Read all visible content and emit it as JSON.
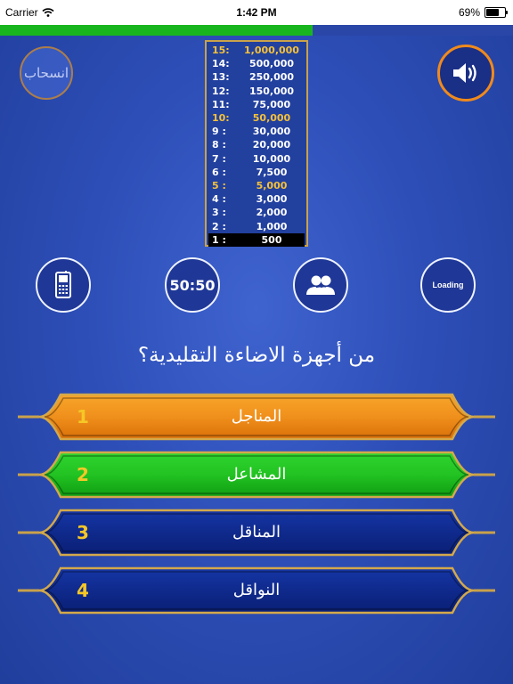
{
  "status_bar": {
    "carrier": "Carrier",
    "time": "1:42 PM",
    "battery": "69%",
    "battery_level": 0.69
  },
  "timer": {
    "progress": 0.61,
    "color": "#19b51f"
  },
  "top_buttons": {
    "withdraw_label": "انسحاب",
    "sound_icon": "speaker-icon"
  },
  "ladder": {
    "rows": [
      {
        "level": "15:",
        "amount": "1,000,000",
        "milestone": true
      },
      {
        "level": "14:",
        "amount": "500,000"
      },
      {
        "level": "13:",
        "amount": "250,000"
      },
      {
        "level": "12:",
        "amount": "150,000"
      },
      {
        "level": "11:",
        "amount": "75,000"
      },
      {
        "level": "10:",
        "amount": "50,000",
        "milestone": true
      },
      {
        "level": "9 :",
        "amount": "30,000"
      },
      {
        "level": "8 :",
        "amount": "20,000"
      },
      {
        "level": "7 :",
        "amount": "10,000"
      },
      {
        "level": "6 :",
        "amount": "7,500"
      },
      {
        "level": "5 :",
        "amount": "5,000",
        "milestone": true
      },
      {
        "level": "4 :",
        "amount": "3,000"
      },
      {
        "level": "3 :",
        "amount": "2,000"
      },
      {
        "level": "2 :",
        "amount": "1,000"
      },
      {
        "level": "1 :",
        "amount": "500",
        "current": true
      }
    ],
    "milestone_color": "#f5c13a"
  },
  "lifelines": {
    "phone_icon": "phone-icon",
    "fifty_fifty_label": "50:50",
    "audience_icon": "audience-icon",
    "loading_label": "Loading"
  },
  "question": {
    "text": "من أجهزة الاضاءة التقليدية؟"
  },
  "answers": [
    {
      "number": "1",
      "text": "المناجل",
      "state": "selected",
      "color": "#f0901c"
    },
    {
      "number": "2",
      "text": "المشاعل",
      "state": "correct",
      "color": "#22c322"
    },
    {
      "number": "3",
      "text": "المناقل",
      "state": "normal",
      "color": "#0f2a8c"
    },
    {
      "number": "4",
      "text": "النواقل",
      "state": "normal",
      "color": "#0f2a8c"
    }
  ]
}
